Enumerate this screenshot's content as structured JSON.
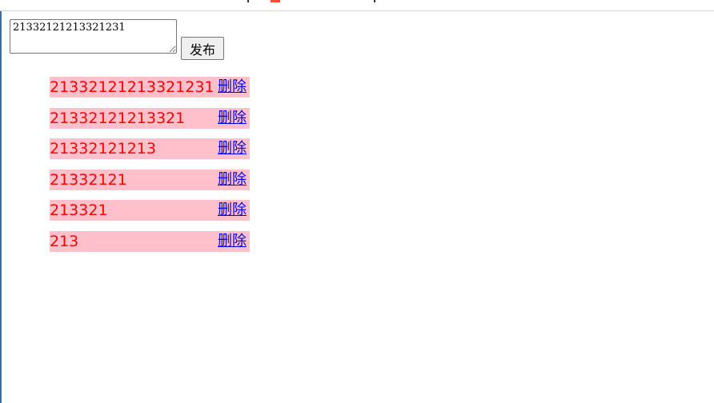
{
  "composer": {
    "value": "21332121213321231",
    "submit_label": "发布"
  },
  "items": [
    {
      "text": "21332121213321231",
      "delete_label": "删除"
    },
    {
      "text": "21332121213321",
      "delete_label": "删除"
    },
    {
      "text": "21332121213",
      "delete_label": "删除"
    },
    {
      "text": "21332121",
      "delete_label": "删除"
    },
    {
      "text": "213321",
      "delete_label": "删除"
    },
    {
      "text": "213",
      "delete_label": "删除"
    }
  ],
  "colors": {
    "item_bg": "#ffc0cb",
    "item_text": "#ff0000",
    "link": "#0000ee"
  }
}
